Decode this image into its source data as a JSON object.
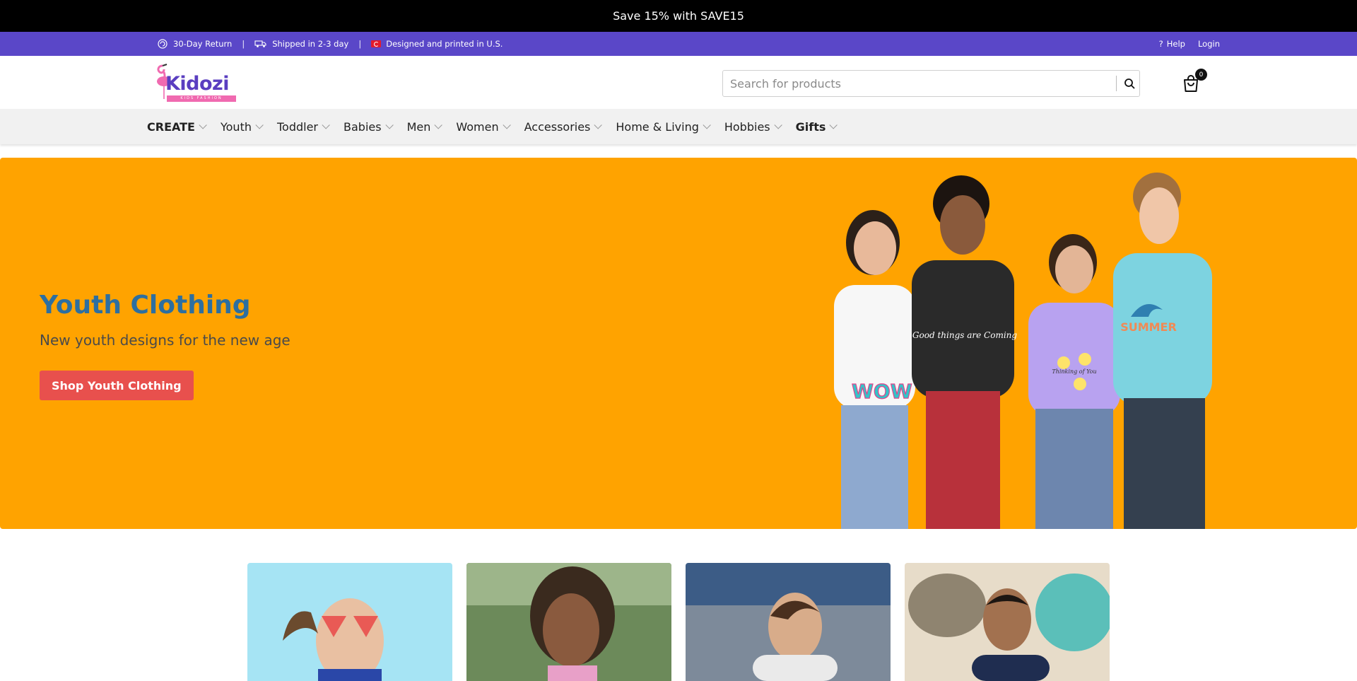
{
  "promo": {
    "text": "Save 15% with SAVE15"
  },
  "infobar": {
    "return_text": "30-Day Return",
    "shipping_text": "Shipped in 2-3 day",
    "designed_text": "Designed and printed in U.S.",
    "separator": "|",
    "help_label": "Help",
    "login_label": "Login"
  },
  "header": {
    "logo_text": "Kidozi",
    "logo_tagline": "KIDS FASHION",
    "search_placeholder": "Search for products",
    "cart_count": "0"
  },
  "nav": {
    "items": [
      {
        "label": "CREATE"
      },
      {
        "label": "Youth"
      },
      {
        "label": "Toddler"
      },
      {
        "label": "Babies"
      },
      {
        "label": "Men"
      },
      {
        "label": "Women"
      },
      {
        "label": "Accessories"
      },
      {
        "label": "Home & Living"
      },
      {
        "label": "Hobbies"
      },
      {
        "label": "Gifts"
      }
    ]
  },
  "hero": {
    "title": "Youth Clothing",
    "subtitle": "New youth designs for the new age",
    "cta_label": "Shop Youth Clothing",
    "shirt_texts": [
      "WOW",
      "Good things are Coming",
      "Thinking of You",
      "SUMMER"
    ]
  },
  "colors": {
    "promo_bg": "#000000",
    "infobar_bg": "#5a47c8",
    "hero_bg": "#ffa300",
    "hero_title": "#2d6fa0",
    "cta_bg": "#e8504d"
  }
}
